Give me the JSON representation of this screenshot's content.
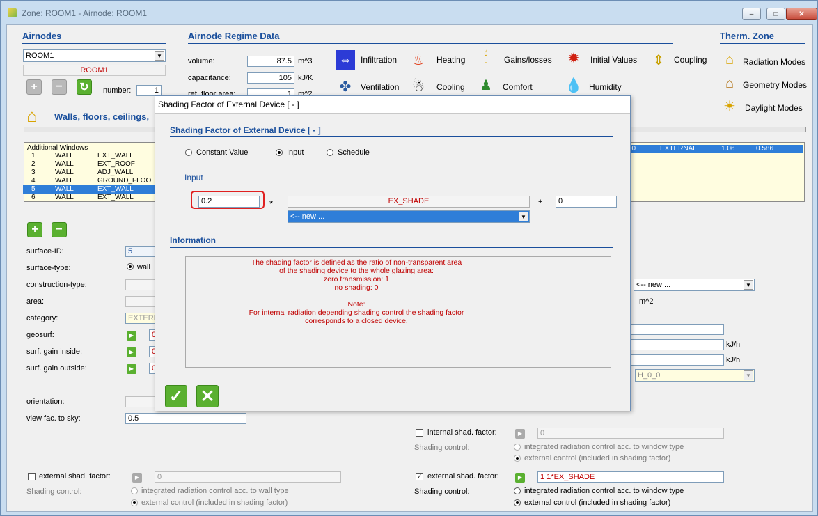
{
  "window": {
    "title": "Zone: ROOM1  -  Airnode: ROOM1",
    "min_label": "–",
    "max_label": "□",
    "close_label": "✕"
  },
  "airnodes": {
    "heading": "Airnodes",
    "selected": "ROOM1",
    "name_display": "ROOM1",
    "number_label": "number:",
    "number_value": "1"
  },
  "regime": {
    "heading": "Airnode Regime Data",
    "volume_label": "volume:",
    "volume_value": "87.5",
    "volume_unit": "m^3",
    "capacitance_label": "capacitance:",
    "capacitance_value": "105",
    "capacitance_unit": "kJ/K",
    "floor_label": "ref. floor area:",
    "floor_value": "1",
    "floor_unit": "m^2",
    "items": [
      "Infiltration",
      "Heating",
      "Gains/losses",
      "Initial Values",
      "Coupling",
      "Ventilation",
      "Cooling",
      "Comfort",
      "Humidity"
    ]
  },
  "therm": {
    "heading": "Therm. Zone",
    "items": [
      "Radiation Modes",
      "Geometry Modes",
      "Daylight Modes"
    ]
  },
  "walls": {
    "heading": "Walls, floors, ceilings,",
    "header_row": "Additional Windows",
    "rows": [
      {
        "n": "1",
        "type": "WALL",
        "name": "EXT_WALL"
      },
      {
        "n": "2",
        "type": "WALL",
        "name": "EXT_ROOF"
      },
      {
        "n": "3",
        "type": "WALL",
        "name": "ADJ_WALL"
      },
      {
        "n": "4",
        "type": "WALL",
        "name": "GROUND_FLOO"
      },
      {
        "n": "5",
        "type": "WALL",
        "name": "EXT_WALL"
      },
      {
        "n": "6",
        "type": "WALL",
        "name": "EXT_WALL"
      }
    ],
    "win_row": {
      "a": "00",
      "b": "EXTERNAL",
      "c": "1.06",
      "d": "0.586"
    }
  },
  "surface": {
    "id_label": "surface-ID:",
    "id_value": "5",
    "type_label": "surface-type:",
    "type_value": "wall",
    "construction_label": "construction-type:",
    "area_label": "area:",
    "category_label": "category:",
    "category_value": "EXTERN",
    "geosurf_label": "geosurf:",
    "geosurf_value": "0",
    "gain_in_label": "surf. gain inside:",
    "gain_in_value": "0",
    "gain_out_label": "surf. gain outside:",
    "gain_out_value": "0",
    "orientation_label": "orientation:",
    "viewfac_label": "view fac. to sky:",
    "viewfac_value": "0.5",
    "ext_shad_label": "external shad. factor:",
    "ext_shad_value": "0",
    "shading_control_label": "Shading control:",
    "opt_integrated_wall": "integrated radiation control acc. to wall type",
    "opt_external": "external control (included in shading factor)"
  },
  "window_side": {
    "construction_value": "<-- new ...",
    "area_unit": "m^2",
    "kjh1": "kJ/h",
    "kjh2": "kJ/h",
    "orient_value": "H_0_0",
    "int_shad_label": "internal shad. factor:",
    "int_shad_value": "0",
    "shading_control_label": "Shading control:",
    "opt_integrated_window": "integrated radiation control acc. to window type",
    "opt_external": "external control (included in shading factor)",
    "ext_shad_label": "external shad. factor:",
    "ext_shad_value": "1 1*EX_SHADE"
  },
  "dialog": {
    "title": "Shading Factor of External Device  [ - ]",
    "heading": "Shading Factor of External Device   [ - ]",
    "opt_constant": "Constant Value",
    "opt_input": "Input",
    "opt_schedule": "Schedule",
    "input_heading": "Input",
    "factor_value": "0.2",
    "times": "*",
    "input_name": "EX_SHADE",
    "input_select": "<-- new ...",
    "plus": "+",
    "offset_value": "0",
    "info_heading": "Information",
    "info_lines": [
      "The shading factor is defined as the ratio of non-transparent area",
      "of the shading device to the whole glazing area:",
      "zero transmission: 1",
      "no shading: 0",
      "",
      "Note:",
      "For internal radiation depending shading control the shading factor",
      "corresponds to a closed device."
    ],
    "ok_label": "✓",
    "cancel_label": "✕"
  }
}
